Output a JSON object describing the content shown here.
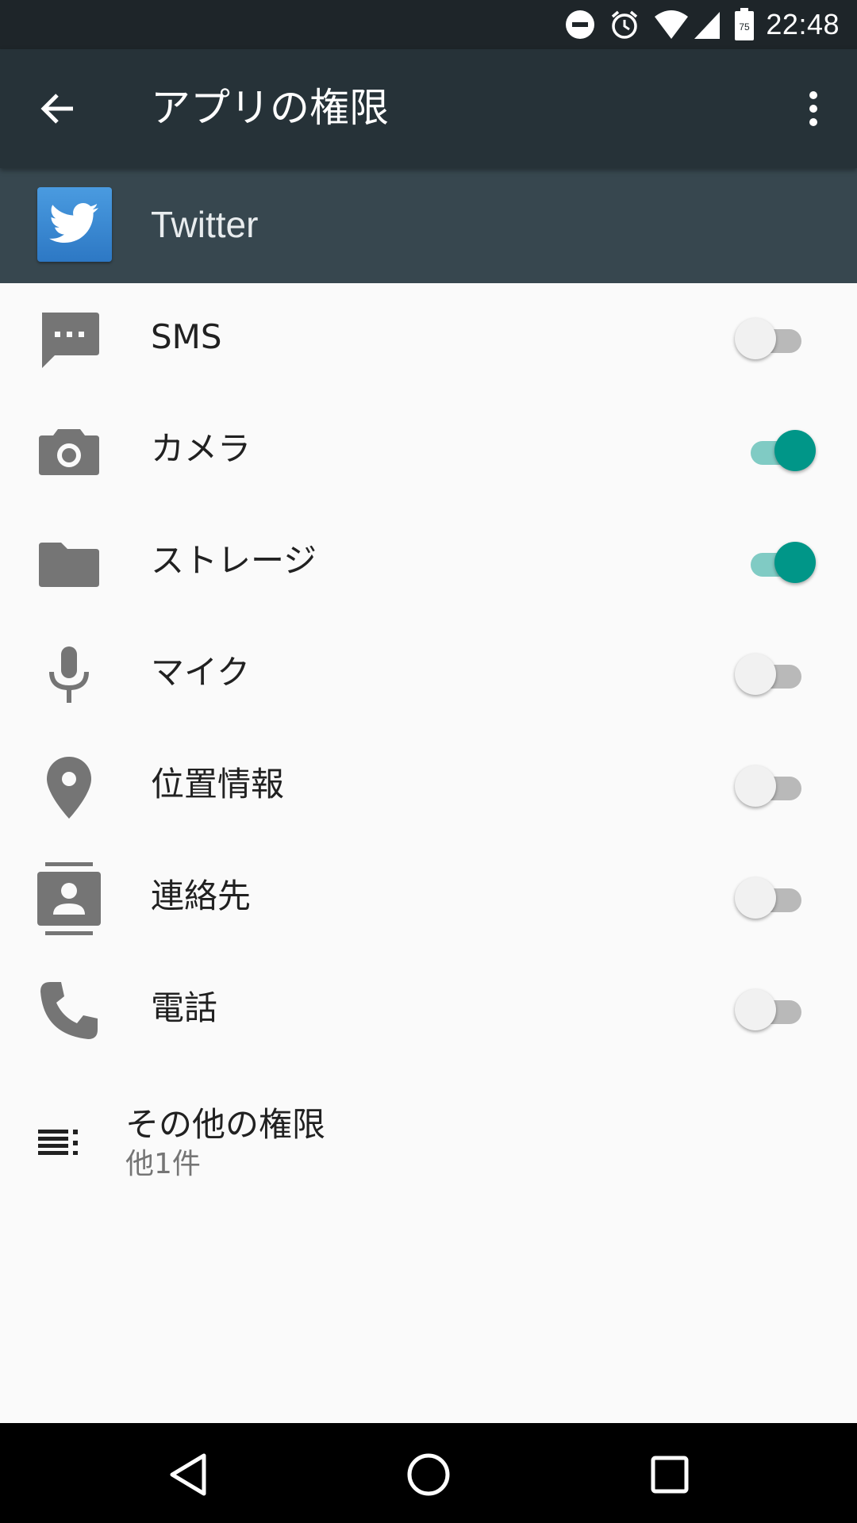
{
  "status_bar": {
    "time": "22:48",
    "battery_level": "75",
    "icons": [
      "do-not-disturb-icon",
      "alarm-icon",
      "wifi-icon",
      "cell-signal-icon",
      "battery-icon"
    ]
  },
  "app_bar": {
    "title": "アプリの権限",
    "back_icon": "arrow-back-icon",
    "menu_icon": "more-vert-icon"
  },
  "app": {
    "name": "Twitter",
    "icon": "twitter-bird-icon",
    "icon_color": "#3b8ad5"
  },
  "permissions": [
    {
      "label": "SMS",
      "icon": "sms-icon",
      "enabled": false
    },
    {
      "label": "カメラ",
      "icon": "camera-icon",
      "enabled": true
    },
    {
      "label": "ストレージ",
      "icon": "folder-icon",
      "enabled": true
    },
    {
      "label": "マイク",
      "icon": "mic-icon",
      "enabled": false
    },
    {
      "label": "位置情報",
      "icon": "location-icon",
      "enabled": false
    },
    {
      "label": "連絡先",
      "icon": "contacts-icon",
      "enabled": false
    },
    {
      "label": "電話",
      "icon": "phone-icon",
      "enabled": false
    }
  ],
  "other_permissions": {
    "title": "その他の権限",
    "subtitle": "他1件",
    "icon": "list-icon"
  },
  "colors": {
    "accent": "#009688",
    "accent_track": "#80cbc4",
    "app_bar": "#263238",
    "header": "#37474f"
  },
  "nav_bar": [
    "back-triangle-icon",
    "home-circle-icon",
    "recents-square-icon"
  ]
}
